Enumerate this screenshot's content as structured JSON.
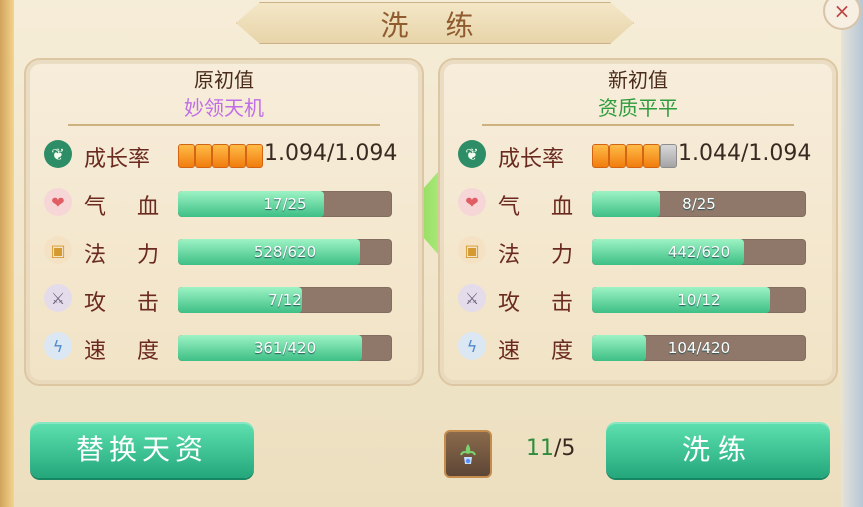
{
  "window": {
    "title": "洗 练"
  },
  "left_panel": {
    "title": "原初值",
    "subtitle": "妙领天机",
    "growth": {
      "label": "成长率",
      "value": "1.094/1.094",
      "stars": [
        1,
        1,
        1,
        1,
        1
      ]
    },
    "stats": [
      {
        "label": "气 血",
        "icon": "heart-icon",
        "value": "17/25",
        "fill": 0.68
      },
      {
        "label": "法 力",
        "icon": "mana-icon",
        "value": "528/620",
        "fill": 0.85
      },
      {
        "label": "攻 击",
        "icon": "sword-icon",
        "value": "7/12",
        "fill": 0.58
      },
      {
        "label": "速 度",
        "icon": "speed-icon",
        "value": "361/420",
        "fill": 0.86
      }
    ]
  },
  "right_panel": {
    "title": "新初值",
    "subtitle": "资质平平",
    "growth": {
      "label": "成长率",
      "value": "1.044/1.094",
      "stars": [
        1,
        1,
        1,
        1,
        0
      ]
    },
    "stats": [
      {
        "label": "气 血",
        "icon": "heart-icon",
        "value": "8/25",
        "fill": 0.32
      },
      {
        "label": "法 力",
        "icon": "mana-icon",
        "value": "442/620",
        "fill": 0.71
      },
      {
        "label": "攻 击",
        "icon": "sword-icon",
        "value": "10/12",
        "fill": 0.83
      },
      {
        "label": "速 度",
        "icon": "speed-icon",
        "value": "104/420",
        "fill": 0.25
      }
    ]
  },
  "actions": {
    "replace_label": "替换天资",
    "wash_label": "洗练",
    "count_have": "11",
    "count_need": "/5"
  },
  "colors": {
    "panel": "#f3e6cb",
    "button": "#34c08e",
    "title": "#8f5b2f"
  }
}
